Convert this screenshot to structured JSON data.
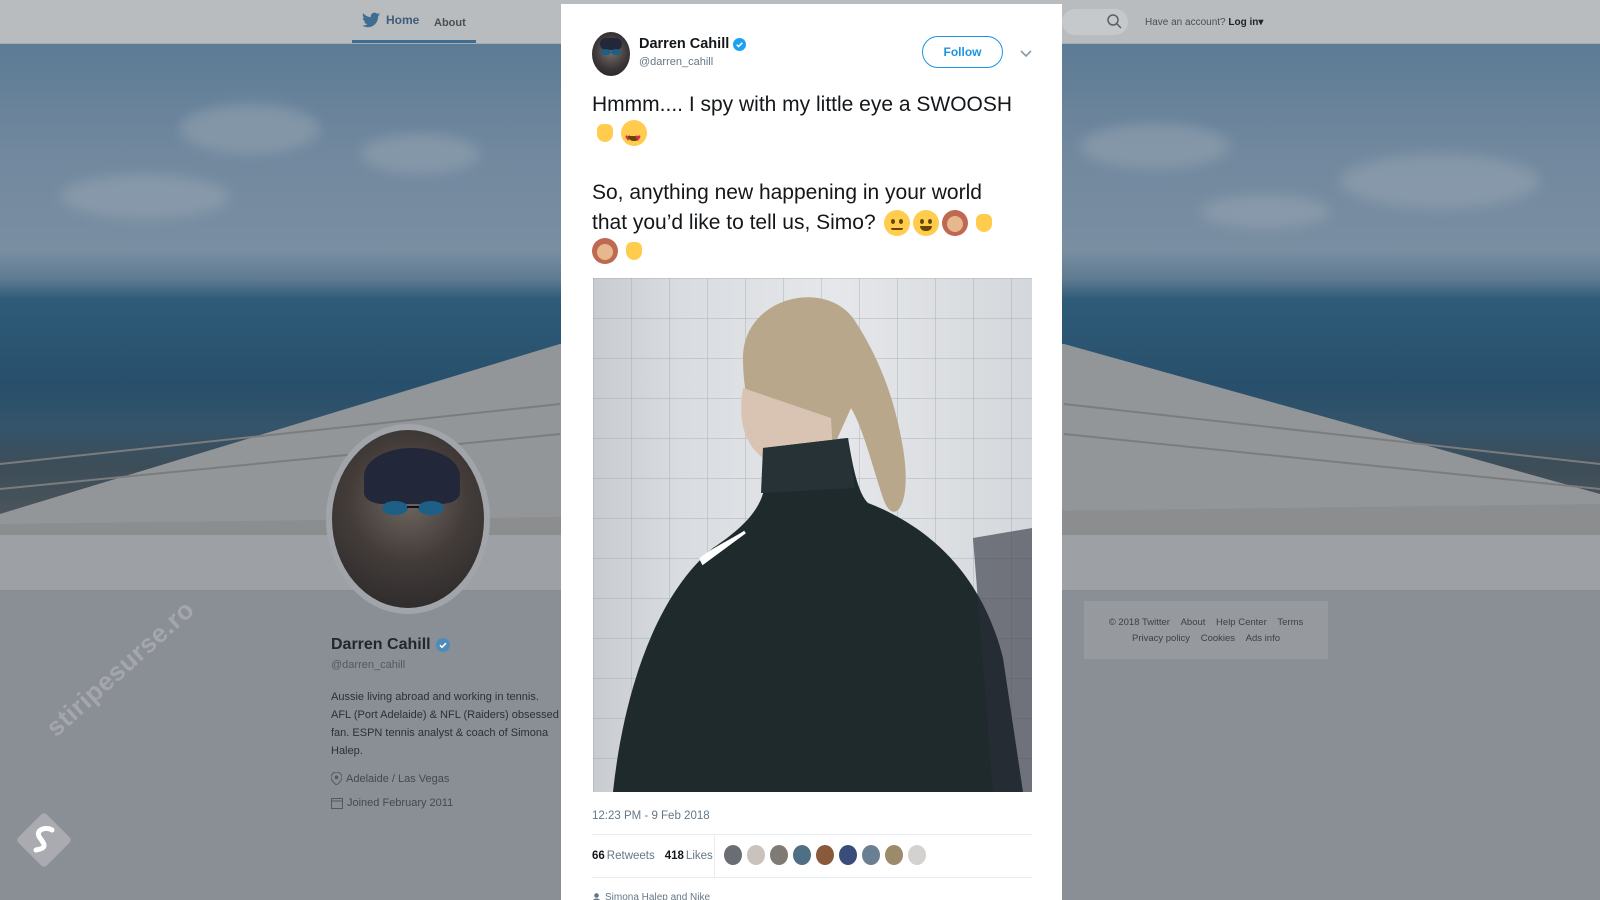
{
  "nav": {
    "home": "Home",
    "about": "About",
    "account_prompt": "Have an account?",
    "login": "Log in"
  },
  "profile": {
    "name": "Darren Cahill",
    "handle": "@darren_cahill",
    "bio": "Aussie living abroad and working in tennis. AFL (Port Adelaide) & NFL (Raiders) obsessed fan. ESPN tennis analyst & coach of Simona Halep.",
    "location": "Adelaide / Las Vegas",
    "joined": "Joined February 2011"
  },
  "footer": {
    "row1": [
      "© 2018 Twitter",
      "About",
      "Help Center",
      "Terms"
    ],
    "row2": [
      "Privacy policy",
      "Cookies",
      "Ads info"
    ]
  },
  "watermark": "stiripesurse.ro",
  "tweet": {
    "author_name": "Darren Cahill",
    "author_handle": "@darren_cahill",
    "follow_label": "Follow",
    "line1": "Hmmm.... I spy with my little eye a SWOOSH",
    "line3": "So, anything new happening in your world",
    "line4": "that you’d like to tell us, Simo?",
    "timestamp": "12:23 PM - 9 Feb 2018",
    "retweets_count": "66",
    "retweets_label": "Retweets",
    "likes_count": "418",
    "likes_label": "Likes",
    "tagged": "Simona Halep and Nike"
  },
  "colors": {
    "twitter_blue": "#1b95e0",
    "verified": "#1da1f2",
    "text_primary": "#14171a",
    "text_secondary": "#657786"
  },
  "icons": [
    "twitter-bird-icon",
    "search-icon",
    "verified-icon",
    "chevron-down-icon",
    "location-pin-icon",
    "calendar-icon",
    "person-icon"
  ]
}
